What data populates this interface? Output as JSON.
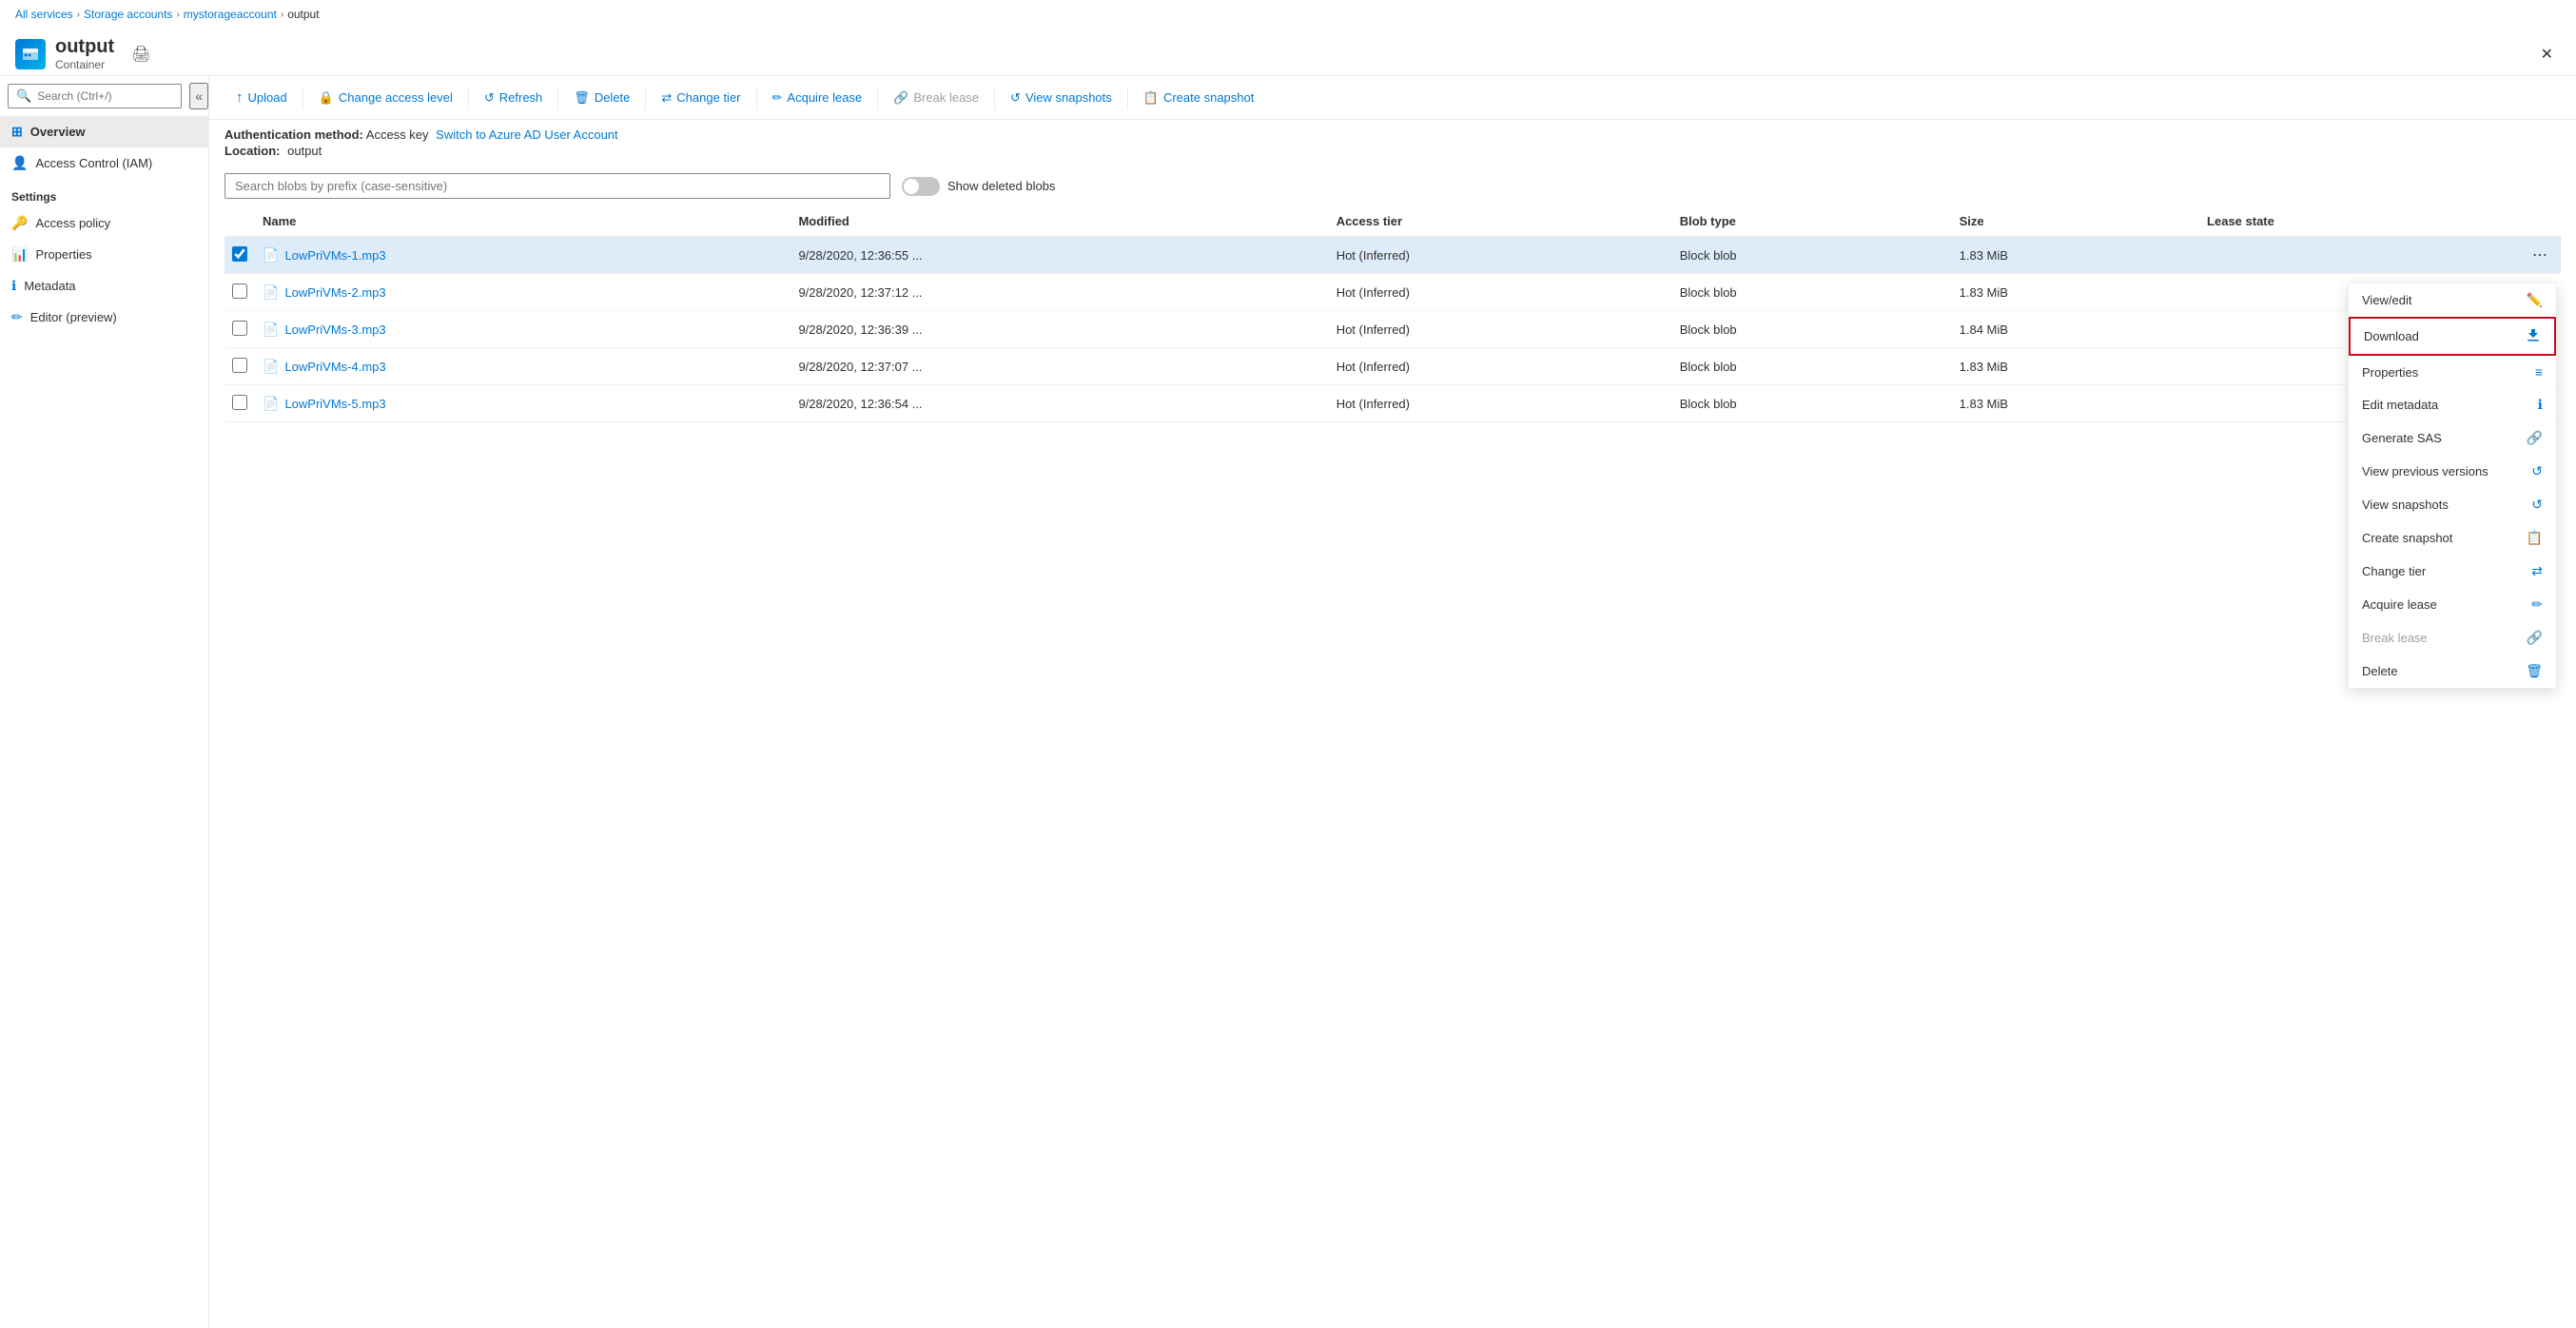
{
  "breadcrumb": {
    "items": [
      "All services",
      "Storage accounts",
      "mystorageaccount",
      "output"
    ]
  },
  "header": {
    "title": "output",
    "subtitle": "Container",
    "close_label": "✕"
  },
  "sidebar": {
    "search_placeholder": "Search (Ctrl+/)",
    "collapse_icon": "«",
    "nav_items": [
      {
        "id": "overview",
        "label": "Overview",
        "active": true
      },
      {
        "id": "access-control",
        "label": "Access Control (IAM)",
        "active": false
      }
    ],
    "settings_label": "Settings",
    "settings_items": [
      {
        "id": "access-policy",
        "label": "Access policy"
      },
      {
        "id": "properties",
        "label": "Properties"
      },
      {
        "id": "metadata",
        "label": "Metadata"
      },
      {
        "id": "editor",
        "label": "Editor (preview)"
      }
    ]
  },
  "toolbar": {
    "buttons": [
      {
        "id": "upload",
        "label": "Upload",
        "icon": "↑",
        "disabled": false
      },
      {
        "id": "change-access",
        "label": "Change access level",
        "icon": "🔒",
        "disabled": false
      },
      {
        "id": "refresh",
        "label": "Refresh",
        "icon": "↺",
        "disabled": false
      },
      {
        "id": "delete",
        "label": "Delete",
        "icon": "🗑",
        "disabled": false
      },
      {
        "id": "change-tier",
        "label": "Change tier",
        "icon": "⇄",
        "disabled": false
      },
      {
        "id": "acquire-lease",
        "label": "Acquire lease",
        "icon": "✏",
        "disabled": false
      },
      {
        "id": "break-lease",
        "label": "Break lease",
        "icon": "🔗",
        "disabled": true
      },
      {
        "id": "view-snapshots",
        "label": "View snapshots",
        "icon": "↺",
        "disabled": false
      },
      {
        "id": "create-snapshot",
        "label": "Create snapshot",
        "icon": "📋",
        "disabled": false
      }
    ]
  },
  "info": {
    "auth_label": "Authentication method:",
    "auth_value": "Access key",
    "auth_link": "Switch to Azure AD User Account",
    "location_label": "Location:",
    "location_value": "output"
  },
  "blob_search": {
    "placeholder": "Search blobs by prefix (case-sensitive)",
    "show_deleted_label": "Show deleted blobs"
  },
  "table": {
    "columns": [
      "",
      "Name",
      "Modified",
      "Access tier",
      "Blob type",
      "Size",
      "Lease state",
      ""
    ],
    "rows": [
      {
        "id": 1,
        "name": "LowPriVMs-1.mp3",
        "modified": "9/28/2020, 12:36:55 ...",
        "access_tier": "Hot (Inferred)",
        "blob_type": "Block blob",
        "size": "1.83 MiB",
        "lease_state": "",
        "selected": true
      },
      {
        "id": 2,
        "name": "LowPriVMs-2.mp3",
        "modified": "9/28/2020, 12:37:12 ...",
        "access_tier": "Hot (Inferred)",
        "blob_type": "Block blob",
        "size": "1.83 MiB",
        "lease_state": "",
        "selected": false
      },
      {
        "id": 3,
        "name": "LowPriVMs-3.mp3",
        "modified": "9/28/2020, 12:36:39 ...",
        "access_tier": "Hot (Inferred)",
        "blob_type": "Block blob",
        "size": "1.84 MiB",
        "lease_state": "",
        "selected": false
      },
      {
        "id": 4,
        "name": "LowPriVMs-4.mp3",
        "modified": "9/28/2020, 12:37:07 ...",
        "access_tier": "Hot (Inferred)",
        "blob_type": "Block blob",
        "size": "1.83 MiB",
        "lease_state": "",
        "selected": false
      },
      {
        "id": 5,
        "name": "LowPriVMs-5.mp3",
        "modified": "9/28/2020, 12:36:54 ...",
        "access_tier": "Hot (Inferred)",
        "blob_type": "Block blob",
        "size": "1.83 MiB",
        "lease_state": "",
        "selected": false
      }
    ]
  },
  "context_menu": {
    "items": [
      {
        "id": "view-edit",
        "label": "View/edit",
        "icon": "✏",
        "disabled": false,
        "highlighted": false
      },
      {
        "id": "download",
        "label": "Download",
        "icon": "↓",
        "disabled": false,
        "highlighted": true
      },
      {
        "id": "properties",
        "label": "Properties",
        "icon": "≡",
        "disabled": false,
        "highlighted": false
      },
      {
        "id": "edit-metadata",
        "label": "Edit metadata",
        "icon": "ℹ",
        "disabled": false,
        "highlighted": false
      },
      {
        "id": "generate-sas",
        "label": "Generate SAS",
        "icon": "🔗",
        "disabled": false,
        "highlighted": false
      },
      {
        "id": "view-previous",
        "label": "View previous versions",
        "icon": "↺",
        "disabled": false,
        "highlighted": false
      },
      {
        "id": "view-snapshots-ctx",
        "label": "View snapshots",
        "icon": "↺",
        "disabled": false,
        "highlighted": false
      },
      {
        "id": "create-snapshot-ctx",
        "label": "Create snapshot",
        "icon": "📋",
        "disabled": false,
        "highlighted": false
      },
      {
        "id": "change-tier-ctx",
        "label": "Change tier",
        "icon": "⇄",
        "disabled": false,
        "highlighted": false
      },
      {
        "id": "acquire-lease-ctx",
        "label": "Acquire lease",
        "icon": "✏",
        "disabled": false,
        "highlighted": false
      },
      {
        "id": "break-lease-ctx",
        "label": "Break lease",
        "icon": "🔗",
        "disabled": true,
        "highlighted": false
      },
      {
        "id": "delete-ctx",
        "label": "Delete",
        "icon": "🗑",
        "disabled": false,
        "highlighted": false
      }
    ]
  }
}
